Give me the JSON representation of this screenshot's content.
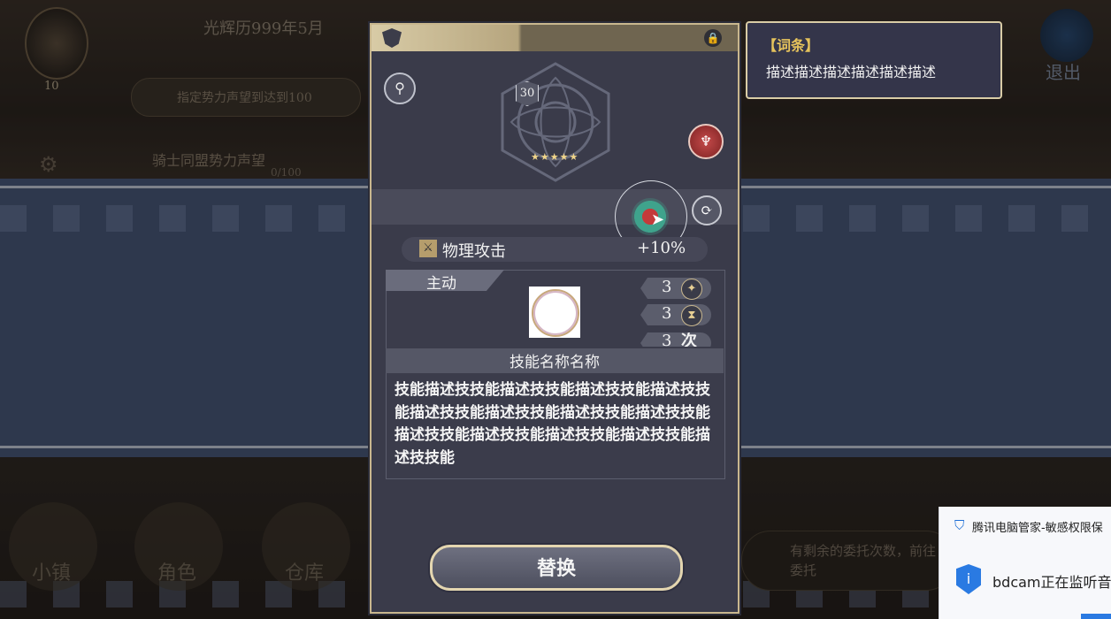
{
  "hud": {
    "level": "10",
    "date": "光辉历999年5月",
    "quest_text": "指定势力声望到达到100",
    "quest_faction": "骑士同盟势力声望",
    "quest_progress": "0/100",
    "exit_label": "退出"
  },
  "nav": {
    "items": [
      {
        "label": "小镇",
        "icon": "castle-icon"
      },
      {
        "label": "角色",
        "icon": "knight-helmet-icon"
      },
      {
        "label": "仓库",
        "icon": "warehouse-icon"
      }
    ],
    "commission_text": "有剩余的委托次数，前往委托"
  },
  "panel": {
    "level": "30",
    "stars": "★★★★★",
    "attribute": {
      "name": "物理攻击",
      "value": "+10%"
    },
    "skill": {
      "type": "主动",
      "stats": [
        {
          "value": "3",
          "icon": "star-icon"
        },
        {
          "value": "3",
          "icon": "hourglass-icon"
        },
        {
          "value": "3",
          "unit": "次"
        }
      ],
      "name": "技能名称名称",
      "description": "技能描述技技能描述技技能描述技技能描述技技能描述技技能描述技技能描述技技能描述技技能描述技技能描述技技能描述技技能描述技技能描述技技能"
    },
    "replace_label": "替换"
  },
  "tooltip": {
    "title": "【词条】",
    "body": "描述描述描述描述描述描述"
  },
  "notification": {
    "title": "腾讯电脑管家-敏感权限保",
    "body": "bdcam正在监听音"
  }
}
